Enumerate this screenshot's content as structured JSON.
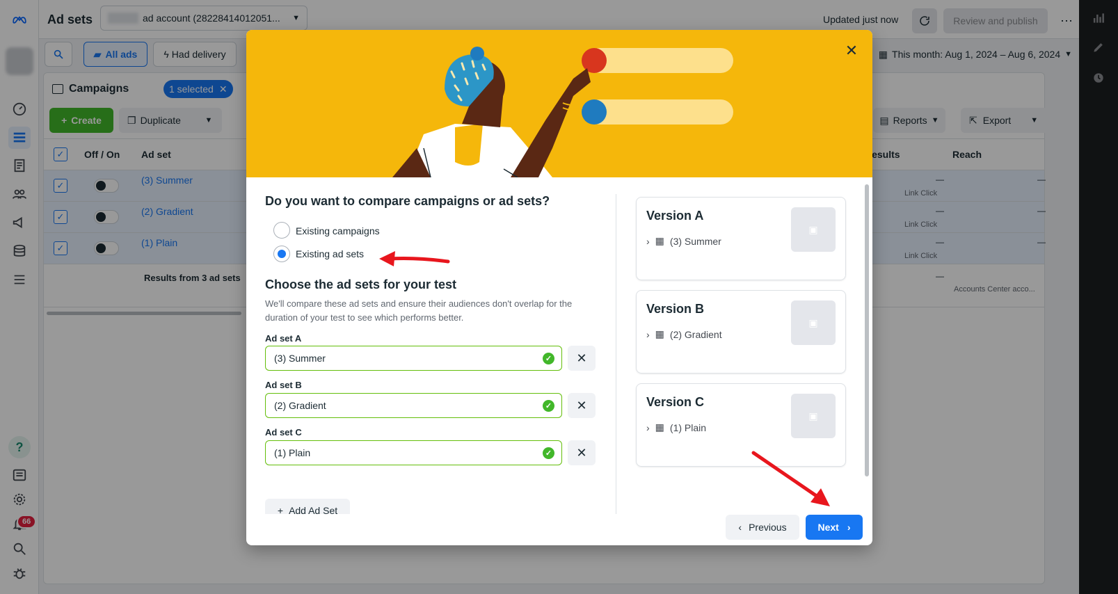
{
  "topbar": {
    "title": "Ad sets",
    "account_label": "ad account (28228414012051...",
    "updated": "Updated just now",
    "review_publish": "Review and publish"
  },
  "filters": {
    "all_ads": "All ads",
    "had_delivery": "Had delivery",
    "date_range": "This month: Aug 1, 2024 – Aug 6, 2024"
  },
  "campaigns": {
    "title": "Campaigns",
    "selected_badge": "1 selected",
    "create": "Create",
    "duplicate": "Duplicate",
    "reports": "Reports",
    "export": "Export",
    "columns": {
      "off_on": "Off / On",
      "ad_set": "Ad set",
      "results": "Results",
      "reach": "Reach"
    },
    "rows": [
      {
        "name": "(3) Summer",
        "result_dash": "—",
        "result_label": "Link Click",
        "reach": "—"
      },
      {
        "name": "(2) Gradient",
        "result_dash": "—",
        "result_label": "Link Click",
        "reach": "—"
      },
      {
        "name": "(1) Plain",
        "result_dash": "—",
        "result_label": "Link Click",
        "reach": "—"
      }
    ],
    "footer": {
      "label": "Results from 3 ad sets",
      "results": "—",
      "reach": "Accounts Center acco..."
    }
  },
  "notifications_count": "66",
  "modal": {
    "question": "Do you want to compare campaigns or ad sets?",
    "options": [
      {
        "label": "Existing campaigns",
        "selected": false
      },
      {
        "label": "Existing ad sets",
        "selected": true
      }
    ],
    "choose_title": "Choose the ad sets for your test",
    "choose_desc": "We'll compare these ad sets and ensure their audiences don't overlap for the duration of your test to see which performs better.",
    "ad_sets": [
      {
        "label": "Ad set A",
        "value": "(3) Summer"
      },
      {
        "label": "Ad set B",
        "value": "(2) Gradient"
      },
      {
        "label": "Ad set C",
        "value": "(1) Plain"
      }
    ],
    "add_ad_set": "Add Ad Set",
    "versions": [
      {
        "title": "Version A",
        "item": "(3) Summer"
      },
      {
        "title": "Version B",
        "item": "(2) Gradient"
      },
      {
        "title": "Version C",
        "item": "(1) Plain"
      }
    ],
    "previous": "Previous",
    "next": "Next"
  },
  "colors": {
    "primary": "#1877f2",
    "hero": "#f5b70b",
    "success": "#42b72a",
    "annotation": "#e8161d"
  }
}
